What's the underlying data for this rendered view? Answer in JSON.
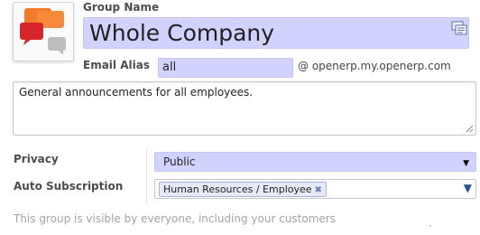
{
  "form": {
    "group_name_label": "Group Name",
    "group_name_value": "Whole Company",
    "email_alias_label": "Email Alias",
    "email_alias_value": "all",
    "email_alias_domain": "@ openerp.my.openerp.com",
    "description": "General announcements for all employees.",
    "privacy_label": "Privacy",
    "privacy_value": "Public",
    "auto_subscription_label": "Auto Subscription",
    "auto_subscription_tags": [
      "Human Resources / Employee"
    ],
    "help_text": "This group is visible by everyone, including your customers"
  },
  "colors": {
    "required_field_bg": "#d2d2ff",
    "label_text": "#4c4c4c",
    "help_text": "#a3a3a3",
    "tag_bg": "#e6eaf6"
  },
  "icons": {
    "logo": "speech-bubbles-icon",
    "translate": "translate-icon",
    "dropdown": "chevron-down-icon",
    "tag_remove": "close-icon"
  }
}
